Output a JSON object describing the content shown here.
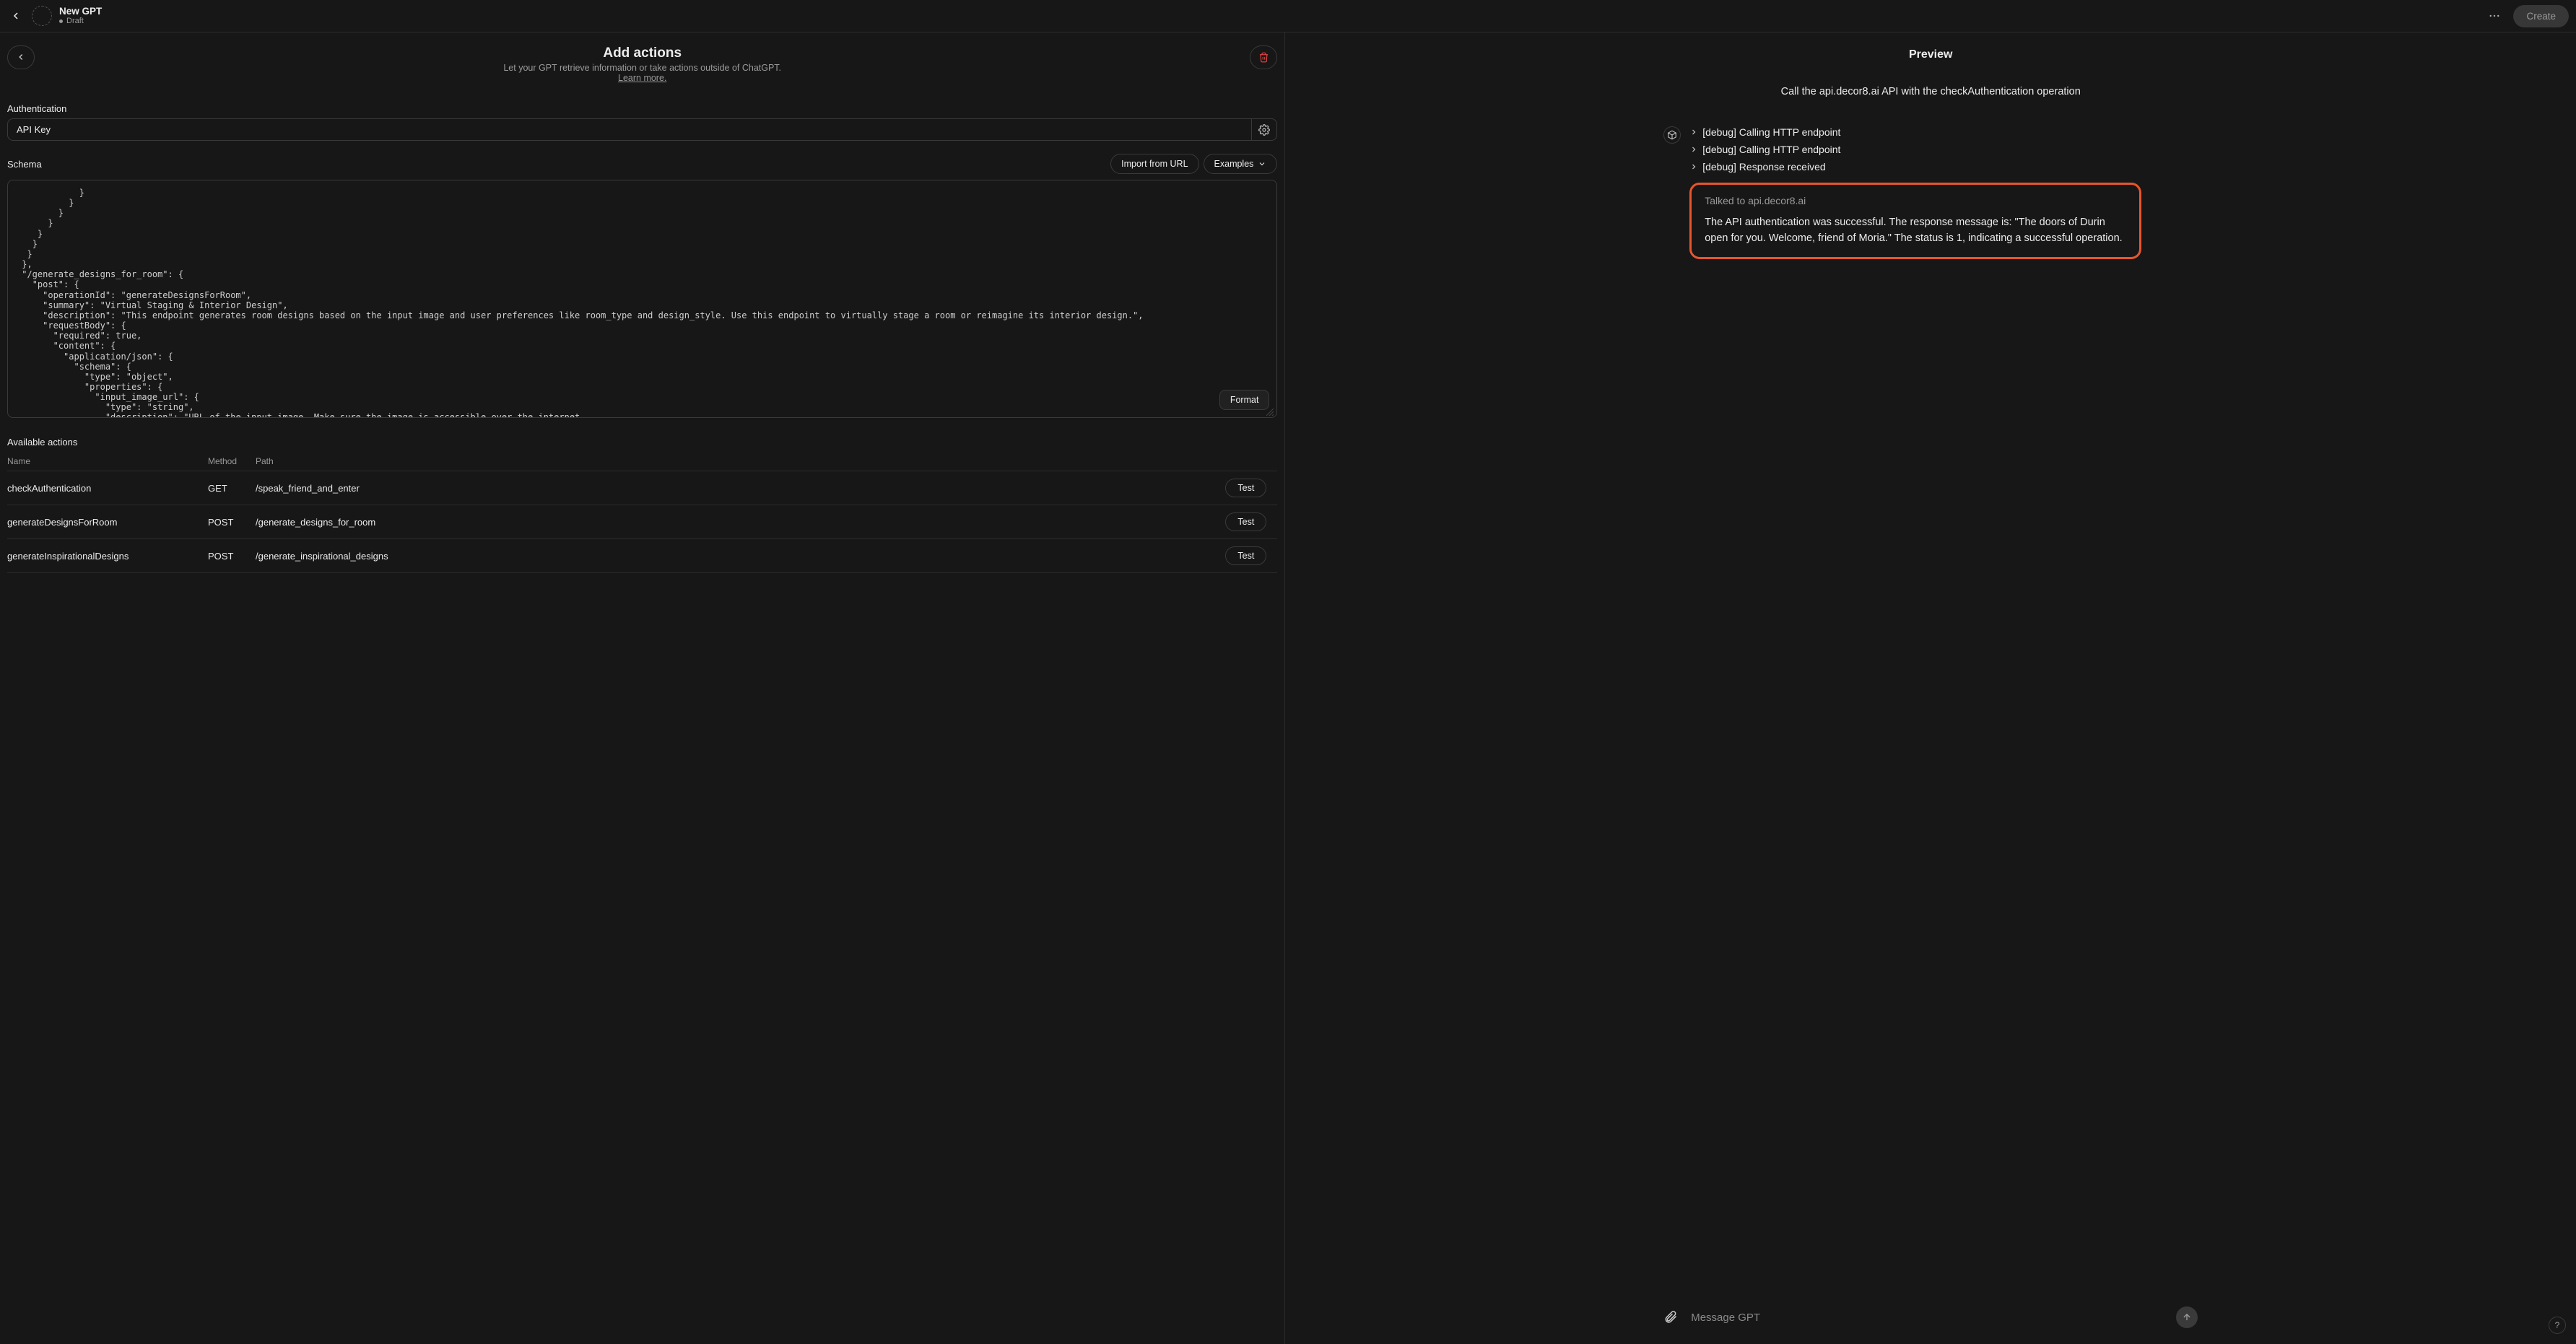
{
  "header": {
    "title": "New GPT",
    "status": "Draft",
    "create_label": "Create"
  },
  "actions_panel": {
    "title": "Add actions",
    "subtitle": "Let your GPT retrieve information or take actions outside of ChatGPT.",
    "learn_more": "Learn more.",
    "auth_label": "Authentication",
    "auth_value": "API Key",
    "schema_label": "Schema",
    "import_url_label": "Import from URL",
    "examples_label": "Examples",
    "format_label": "Format",
    "schema_text": "            }\n          }\n        }\n      }\n    }\n   }\n  }\n },\n \"/generate_designs_for_room\": {\n   \"post\": {\n     \"operationId\": \"generateDesignsForRoom\",\n     \"summary\": \"Virtual Staging & Interior Design\",\n     \"description\": \"This endpoint generates room designs based on the input image and user preferences like room_type and design_style. Use this endpoint to virtually stage a room or reimagine its interior design.\",\n     \"requestBody\": {\n       \"required\": true,\n       \"content\": {\n         \"application/json\": {\n           \"schema\": {\n             \"type\": \"object\",\n             \"properties\": {\n               \"input_image_url\": {\n                 \"type\": \"string\",\n                 \"description\": \"URL of the input image. Make sure the image is accessible over the internet",
    "available_label": "Available actions",
    "columns": {
      "name": "Name",
      "method": "Method",
      "path": "Path"
    },
    "rows": [
      {
        "name": "checkAuthentication",
        "method": "GET",
        "path": "/speak_friend_and_enter",
        "test": "Test"
      },
      {
        "name": "generateDesignsForRoom",
        "method": "POST",
        "path": "/generate_designs_for_room",
        "test": "Test"
      },
      {
        "name": "generateInspirationalDesigns",
        "method": "POST",
        "path": "/generate_inspirational_designs",
        "test": "Test"
      }
    ]
  },
  "preview": {
    "title": "Preview",
    "prompt": "Call the api.decor8.ai API with the checkAuthentication operation",
    "debug": [
      "[debug] Calling HTTP endpoint",
      "[debug] Calling HTTP endpoint",
      "[debug] Response received"
    ],
    "talked_to": "Talked to api.decor8.ai",
    "response": "The API authentication was successful. The response message is: \"The doors of Durin open for you. Welcome, friend of Moria.\" The status is 1, indicating a successful operation.",
    "composer_placeholder": "Message GPT"
  }
}
